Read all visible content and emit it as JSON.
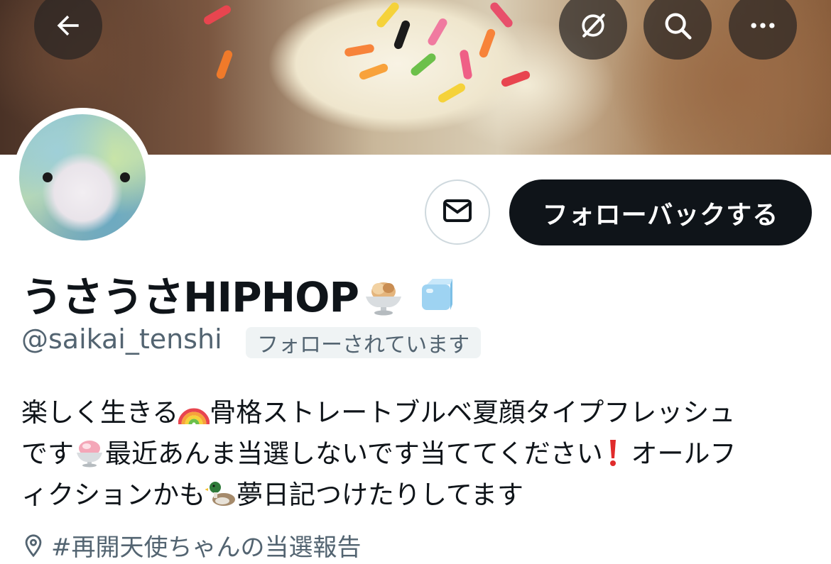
{
  "header": {
    "back_icon": "arrow-left-icon",
    "buttons": [
      "grok-icon",
      "search-icon",
      "more-icon"
    ]
  },
  "profile": {
    "display_name": "うさうさHIPHOP",
    "name_emojis": [
      "ice-cream-emoji",
      "ice-cube-emoji"
    ],
    "handle": "@saikai_tenshi",
    "follows_you_badge": "フォローされています",
    "follow_back_label": "フォローバックする",
    "message_icon": "mail-icon",
    "bio": {
      "part1": "楽しく生きる",
      "part2": "骨格ストレートブルベ夏顔タイプフレッシュ",
      "part3": "です",
      "part4": "最近あんま当選しないです当ててください",
      "part5": " オールフ",
      "part6": "ィクションかも",
      "part7": "夢日記つけたりしてます"
    },
    "location_partial": "#再開天使ちゃんの当選報告"
  },
  "colors": {
    "text_primary": "#0f1419",
    "text_secondary": "#536471",
    "badge_bg": "#eff3f4",
    "button_dark": "#0f1419"
  }
}
